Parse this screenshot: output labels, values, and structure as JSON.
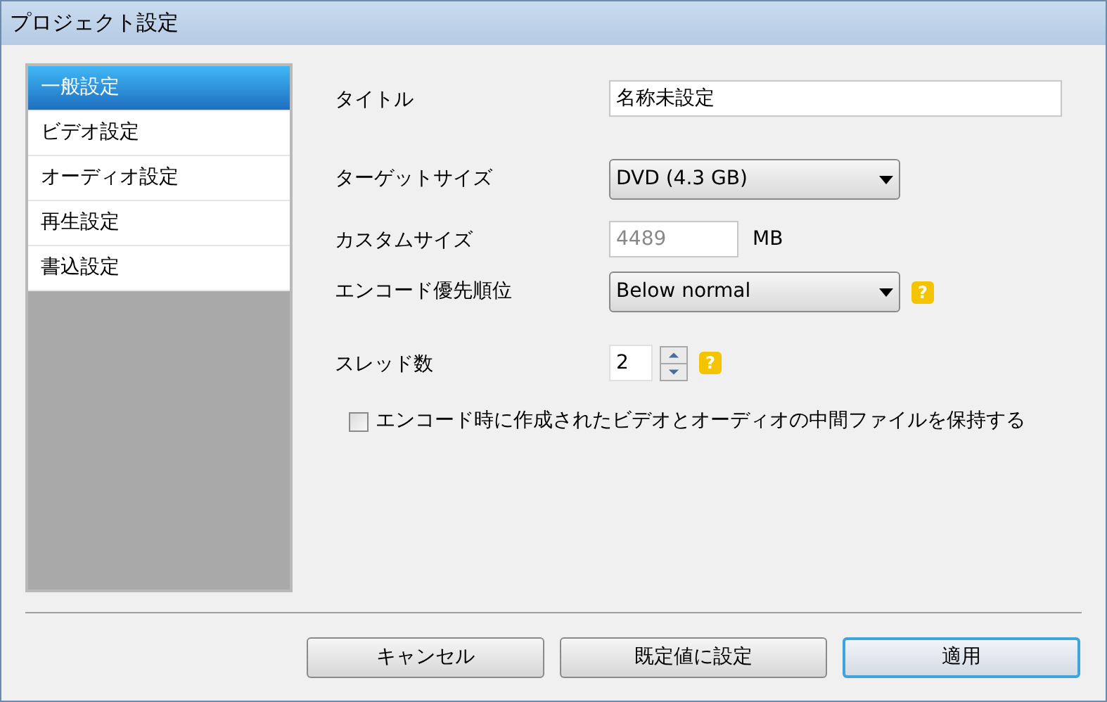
{
  "window": {
    "title": "プロジェクト設定"
  },
  "sidebar": {
    "items": [
      {
        "label": "一般設定",
        "selected": true
      },
      {
        "label": "ビデオ設定",
        "selected": false
      },
      {
        "label": "オーディオ設定",
        "selected": false
      },
      {
        "label": "再生設定",
        "selected": false
      },
      {
        "label": "書込設定",
        "selected": false
      }
    ]
  },
  "form": {
    "rows": [
      {
        "kind": "text",
        "label": "タイトル",
        "value": "名称未設定"
      },
      {
        "kind": "select",
        "label": "ターゲットサイズ",
        "value": "DVD (4.3 GB)"
      },
      {
        "kind": "number",
        "label": "カスタムサイズ",
        "value": "4489",
        "unit": "MB",
        "disabled": true
      },
      {
        "kind": "select",
        "label": "エンコード優先順位",
        "value": "Below normal",
        "help": "?"
      },
      {
        "kind": "spin",
        "label": "スレッド数",
        "value": "2",
        "help": "?"
      }
    ],
    "checkbox": {
      "label": "エンコード時に作成されたビデオとオーディオの中間ファイルを保持する",
      "checked": false
    }
  },
  "buttons": [
    {
      "label": "キャンセル",
      "focused": false
    },
    {
      "label": "既定値に設定",
      "focused": false
    },
    {
      "label": "適用",
      "focused": true
    }
  ]
}
